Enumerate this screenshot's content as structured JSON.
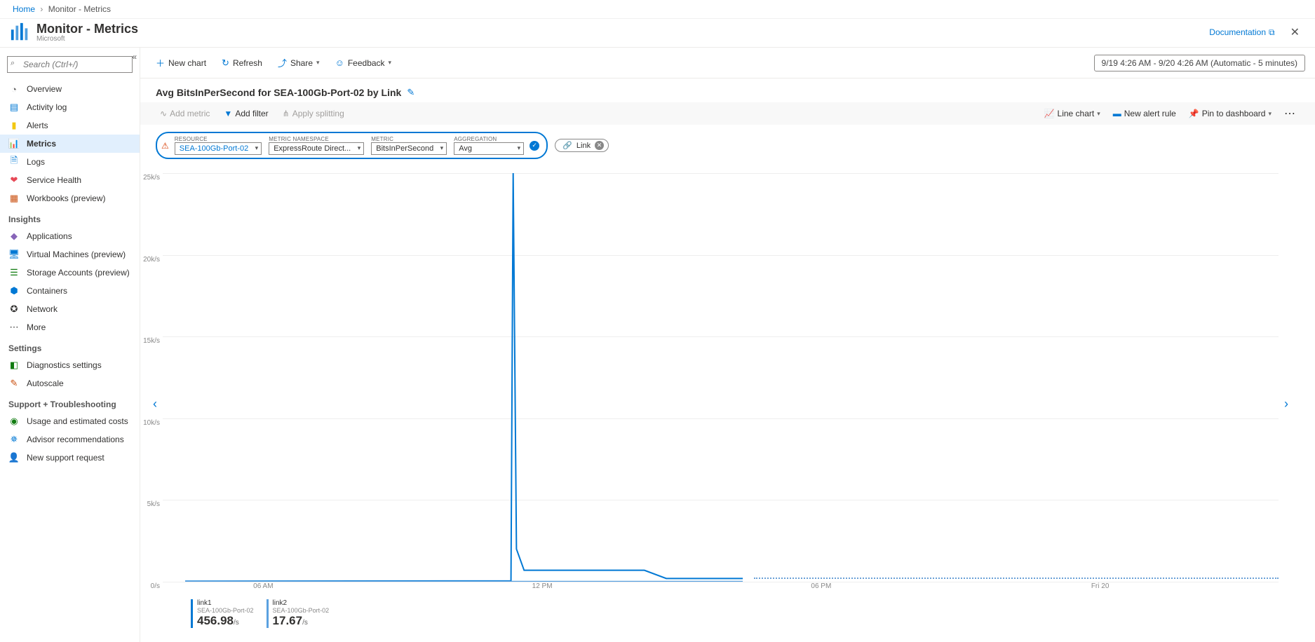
{
  "breadcrumb": {
    "home": "Home",
    "current": "Monitor - Metrics"
  },
  "title": {
    "main": "Monitor - Metrics",
    "sub": "Microsoft"
  },
  "header": {
    "documentation": "Documentation"
  },
  "search": {
    "placeholder": "Search (Ctrl+/)"
  },
  "sidebar": {
    "items": [
      {
        "label": "Overview",
        "icon": "◔",
        "color": "#666"
      },
      {
        "label": "Activity log",
        "icon": "▤",
        "color": "#0078d4"
      },
      {
        "label": "Alerts",
        "icon": "▮",
        "color": "#f2c811"
      },
      {
        "label": "Metrics",
        "icon": "📊",
        "color": "#0078d4"
      },
      {
        "label": "Logs",
        "icon": "🗎",
        "color": "#0078d4"
      },
      {
        "label": "Service Health",
        "icon": "❤",
        "color": "#e74856"
      },
      {
        "label": "Workbooks (preview)",
        "icon": "▦",
        "color": "#ca5010"
      }
    ],
    "insights_header": "Insights",
    "insights": [
      {
        "label": "Applications",
        "icon": "◆",
        "color": "#8764b8"
      },
      {
        "label": "Virtual Machines (preview)",
        "icon": "🖥",
        "color": "#0078d4"
      },
      {
        "label": "Storage Accounts (preview)",
        "icon": "☰",
        "color": "#107c10"
      },
      {
        "label": "Containers",
        "icon": "⬢",
        "color": "#0078d4"
      },
      {
        "label": "Network",
        "icon": "✪",
        "color": "#323130"
      },
      {
        "label": "More",
        "icon": "⋯",
        "color": "#323130"
      }
    ],
    "settings_header": "Settings",
    "settings": [
      {
        "label": "Diagnostics settings",
        "icon": "◧",
        "color": "#107c10"
      },
      {
        "label": "Autoscale",
        "icon": "✎",
        "color": "#ca5010"
      }
    ],
    "support_header": "Support + Troubleshooting",
    "support": [
      {
        "label": "Usage and estimated costs",
        "icon": "◉",
        "color": "#107c10"
      },
      {
        "label": "Advisor recommendations",
        "icon": "✵",
        "color": "#0078d4"
      },
      {
        "label": "New support request",
        "icon": "👤",
        "color": "#0078d4"
      }
    ]
  },
  "toolbar": {
    "new_chart": "New chart",
    "refresh": "Refresh",
    "share": "Share",
    "feedback": "Feedback",
    "time_range": "9/19 4:26 AM - 9/20 4:26 AM (Automatic - 5 minutes)"
  },
  "chart_title": "Avg BitsInPerSecond for SEA-100Gb-Port-02 by Link",
  "subtoolbar": {
    "add_metric": "Add metric",
    "add_filter": "Add filter",
    "apply_splitting": "Apply splitting",
    "line_chart": "Line chart",
    "new_alert": "New alert rule",
    "pin": "Pin to dashboard"
  },
  "selectors": {
    "resource_label": "RESOURCE",
    "resource": "SEA-100Gb-Port-02",
    "namespace_label": "METRIC NAMESPACE",
    "namespace": "ExpressRoute Direct...",
    "metric_label": "METRIC",
    "metric": "BitsInPerSecond",
    "agg_label": "AGGREGATION",
    "agg": "Avg",
    "link_label": "Link"
  },
  "chart_data": {
    "type": "line",
    "ylabel": "",
    "ylim": [
      0,
      25000
    ],
    "y_ticks": [
      "0/s",
      "5k/s",
      "10k/s",
      "15k/s",
      "20k/s",
      "25k/s"
    ],
    "x_ticks": [
      {
        "label": "06 AM",
        "pos": 7
      },
      {
        "label": "12 PM",
        "pos": 32
      },
      {
        "label": "06 PM",
        "pos": 57
      },
      {
        "label": "Fri 20",
        "pos": 82
      }
    ],
    "series": [
      {
        "name": "link1",
        "sub": "SEA-100Gb-Port-02",
        "value": "456.98",
        "unit": "/s",
        "color": "#0078d4"
      },
      {
        "name": "link2",
        "sub": "SEA-100Gb-Port-02",
        "value": "17.67",
        "unit": "/s",
        "color": "#5ba1e0"
      }
    ],
    "spike": {
      "x_pct": 30,
      "peak": 25000,
      "plateau_start_pct": 31,
      "plateau_end_pct": 42,
      "plateau_value": 700,
      "tail_value": 200,
      "dotted_from_pct": 51
    }
  }
}
